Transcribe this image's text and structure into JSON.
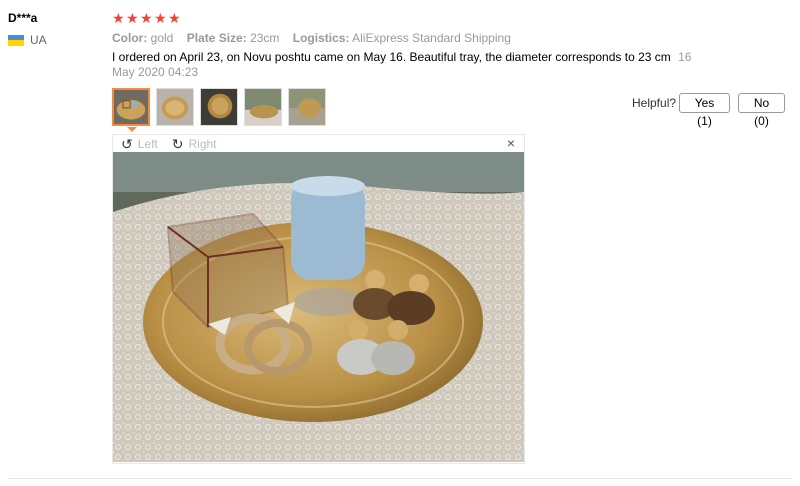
{
  "reviewer": {
    "name": "D***a",
    "country": "UA"
  },
  "rating": {
    "stars": 5,
    "star_glyph": "★",
    "color": "#f44336"
  },
  "attributes": [
    {
      "key": "Color:",
      "value": "gold"
    },
    {
      "key": "Plate Size:",
      "value": "23cm"
    },
    {
      "key": "Logistics:",
      "value": "AliExpress Standard Shipping"
    }
  ],
  "review": {
    "text": "I ordered on April 23, on Novu poshtu came on May 16. Beautiful tray, the diameter corresponds to 23 cm",
    "date": "16 May 2020 04:23"
  },
  "helpful": {
    "label": "Helpful?",
    "yes": "Yes (1)",
    "no": "No (0)"
  },
  "viewer": {
    "left": "Left",
    "right": "Right",
    "close": "×"
  },
  "thumbnails": [
    "photo-1",
    "photo-2",
    "photo-3",
    "photo-4",
    "photo-5"
  ],
  "colors": {
    "accent": "#f58a3a"
  }
}
